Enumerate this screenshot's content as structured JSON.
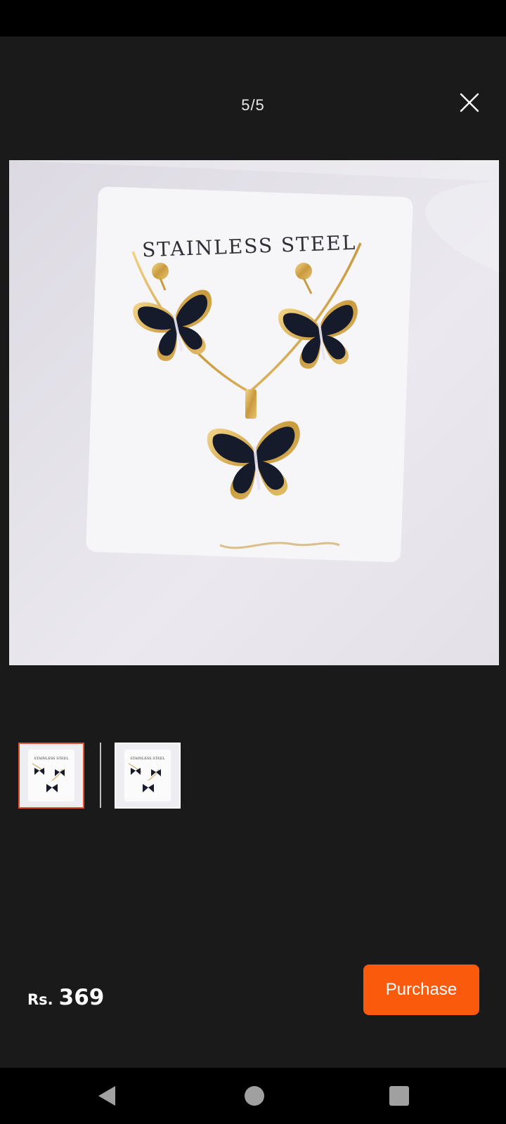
{
  "viewer": {
    "page_counter": "5/5"
  },
  "product_image": {
    "card_text": "STAINLESS STEEL"
  },
  "thumbnails": [
    {
      "card_text": "STAINLESS STEEL",
      "selected": true
    },
    {
      "card_text": "STAINLESS STEEL",
      "selected": false
    }
  ],
  "price": {
    "currency": "Rs.",
    "amount": "369"
  },
  "purchase": {
    "label": "Purchase"
  },
  "colors": {
    "background": "#1a1a1a",
    "accent": "#fa5a0c",
    "selected_thumb_border": "#e0502a"
  },
  "icons": {
    "close": "close-icon",
    "back": "back-icon",
    "home": "home-icon",
    "recents": "recents-icon"
  }
}
